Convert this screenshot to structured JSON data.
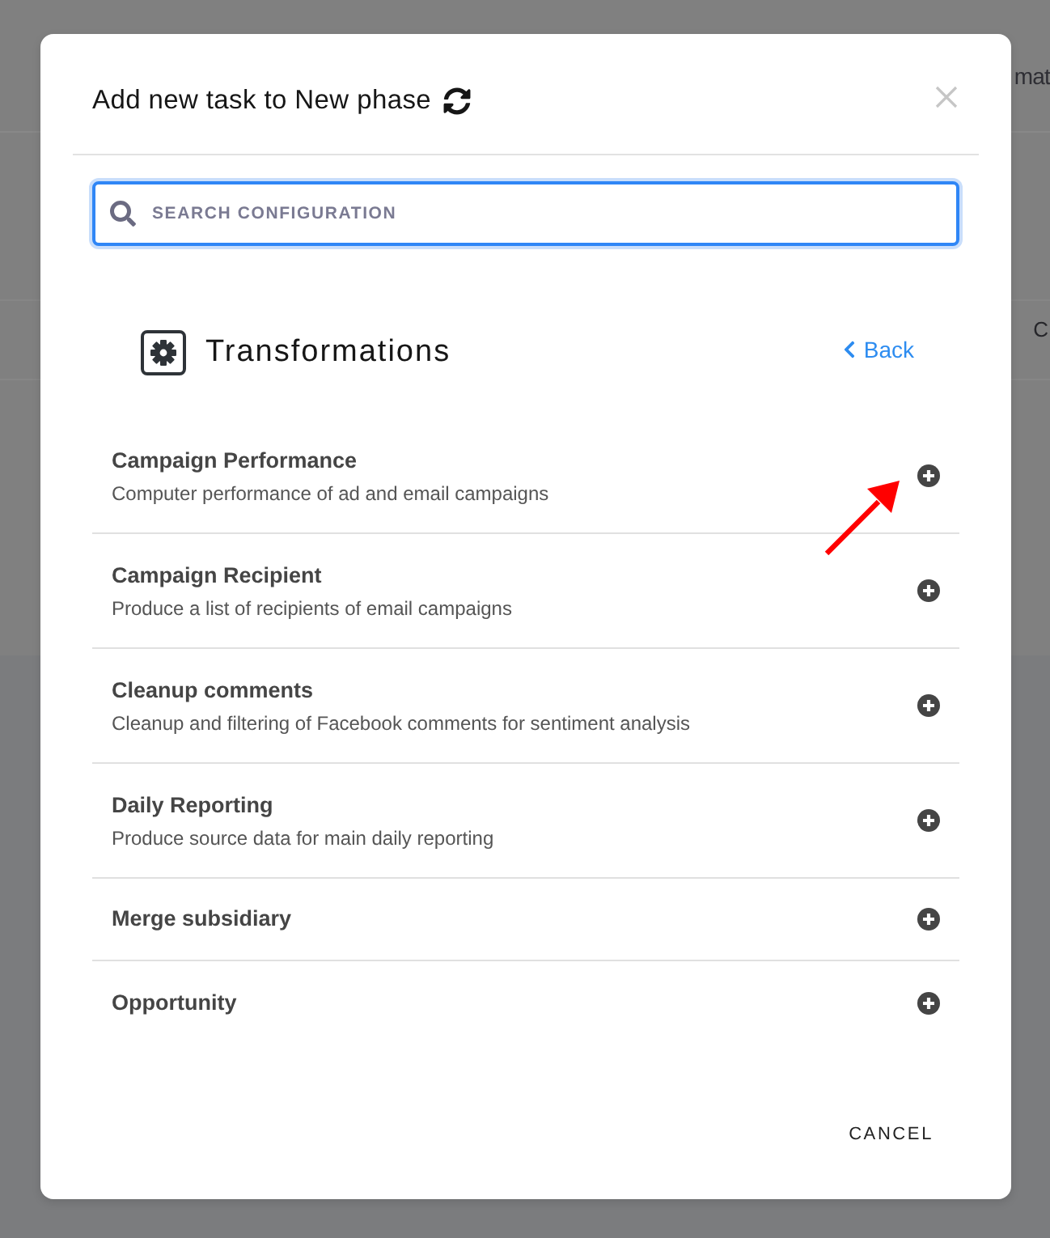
{
  "background": {
    "texts": [
      "mat",
      "C"
    ]
  },
  "dialog": {
    "title": "Add new task to New phase",
    "search": {
      "placeholder": "SEARCH CONFIGURATION"
    },
    "category": {
      "title": "Transformations",
      "back_link": "Back"
    },
    "tasks": [
      {
        "name": "Campaign Performance",
        "description": "Computer performance of ad and email campaigns"
      },
      {
        "name": "Campaign Recipient",
        "description": "Produce a list of recipients of email campaigns"
      },
      {
        "name": "Cleanup comments",
        "description": "Cleanup and filtering of Facebook comments for sentiment analysis"
      },
      {
        "name": "Daily Reporting",
        "description": "Produce source data for main daily reporting"
      },
      {
        "name": "Merge subsidiary"
      },
      {
        "name": "Opportunity"
      }
    ],
    "buttons": [
      "CANCEL"
    ]
  }
}
